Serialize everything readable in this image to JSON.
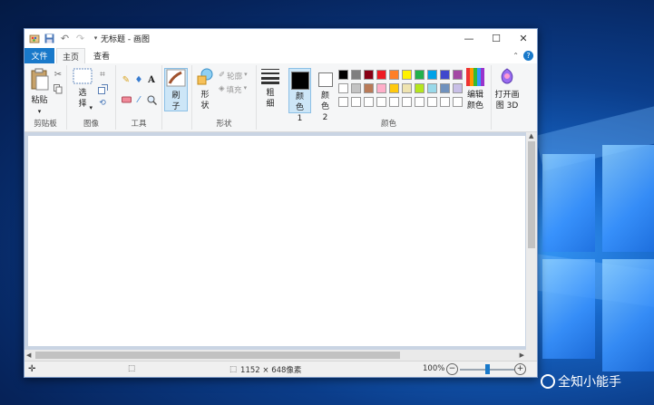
{
  "window": {
    "title": "无标题 - 画图",
    "controls": {
      "minimize": "—",
      "maximize": "☐",
      "close": "✕"
    }
  },
  "tabs": {
    "file": "文件",
    "home": "主页",
    "view": "查看"
  },
  "ribbon": {
    "clipboard": {
      "paste": "粘贴",
      "group_label": "剪贴板"
    },
    "image": {
      "select": "选择",
      "group_label": "图像"
    },
    "tools": {
      "group_label": "工具"
    },
    "brushes": {
      "label": "刷子",
      "group_label": ""
    },
    "shapes": {
      "label": "形状",
      "outline": "轮廓",
      "fill": "填充",
      "group_label": "形状"
    },
    "size": {
      "label": "粗细"
    },
    "colors": {
      "color1": "颜色 1",
      "color2": "颜色 2",
      "edit": "编辑颜色",
      "group_label": "颜色",
      "color1_value": "#000000",
      "color2_value": "#ffffff",
      "palette_row1": [
        "#000000",
        "#7f7f7f",
        "#880015",
        "#ed1c24",
        "#ff7f27",
        "#fff200",
        "#22b14c",
        "#00a2e8",
        "#3f48cc",
        "#a349a4"
      ],
      "palette_row2": [
        "#ffffff",
        "#c3c3c3",
        "#b97a57",
        "#ffaec9",
        "#ffc90e",
        "#efe4b0",
        "#b5e61d",
        "#99d9ea",
        "#7092be",
        "#c8bfe7"
      ],
      "palette_row3": [
        "#ffffff",
        "#ffffff",
        "#ffffff",
        "#ffffff",
        "#ffffff",
        "#ffffff",
        "#ffffff",
        "#ffffff",
        "#ffffff",
        "#ffffff"
      ]
    },
    "paint3d": {
      "label": "打开画图 3D"
    }
  },
  "status": {
    "dimensions": "1152 × 648像素",
    "zoom": "100%",
    "zoom_level": 0.5
  },
  "watermark": "@全知小能手"
}
